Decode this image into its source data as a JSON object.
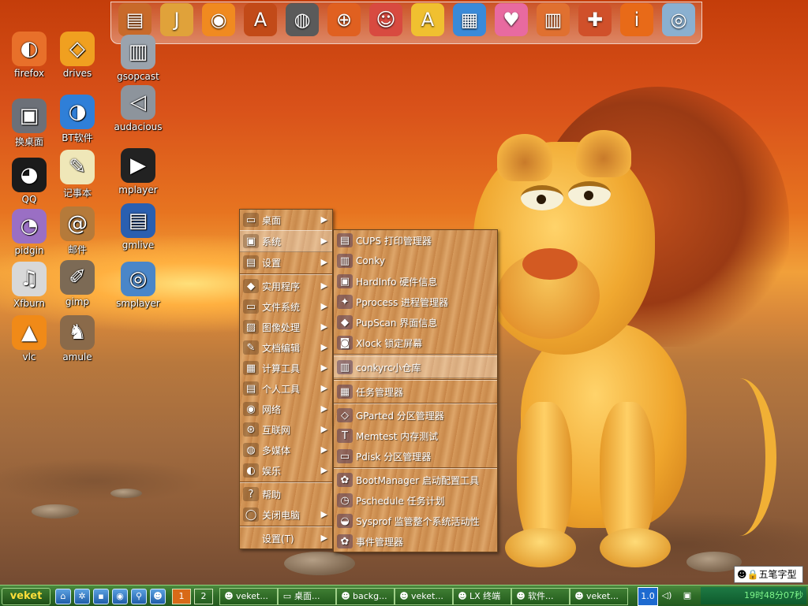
{
  "dock": {
    "icons": [
      {
        "name": "package-icon",
        "glyph": "▤"
      },
      {
        "name": "java-icon",
        "glyph": "J"
      },
      {
        "name": "feeds-icon",
        "glyph": "◉"
      },
      {
        "name": "draw-icon",
        "glyph": "A"
      },
      {
        "name": "media-player-icon",
        "glyph": "◍"
      },
      {
        "name": "globe-icon",
        "glyph": "⊕"
      },
      {
        "name": "cat-icon",
        "glyph": "☺"
      },
      {
        "name": "font-icon",
        "glyph": "A"
      },
      {
        "name": "spreadsheet-icon",
        "glyph": "▦"
      },
      {
        "name": "drink-icon",
        "glyph": "♥"
      },
      {
        "name": "book-icon",
        "glyph": "▥"
      },
      {
        "name": "toolbox-icon",
        "glyph": "✚"
      },
      {
        "name": "info-icon",
        "glyph": "i"
      },
      {
        "name": "database-icon",
        "glyph": "◎"
      }
    ]
  },
  "desktop": {
    "icons": [
      {
        "id": "firefox",
        "label": "firefox",
        "glyph": "◐",
        "bg": "#e8702a"
      },
      {
        "id": "drives",
        "label": "drives",
        "glyph": "◇",
        "bg": "#f0a020"
      },
      {
        "id": "gsopcast",
        "label": "gsopcast",
        "glyph": "▥",
        "bg": "#9aa3ad"
      },
      {
        "id": "switch-desktop",
        "label": "换桌面",
        "glyph": "▣",
        "bg": "#6c7078"
      },
      {
        "id": "bt",
        "label": "BT软件",
        "glyph": "◑",
        "bg": "#2f7fd8"
      },
      {
        "id": "audacious",
        "label": "audacious",
        "glyph": "◁",
        "bg": "#8d949c"
      },
      {
        "id": "qq",
        "label": "QQ",
        "glyph": "◕",
        "bg": "#1b1b1b"
      },
      {
        "id": "notepad",
        "label": "记事本",
        "glyph": "✎",
        "bg": "#efe7b8"
      },
      {
        "id": "mplayer",
        "label": "mplayer",
        "glyph": "▶",
        "bg": "#222222"
      },
      {
        "id": "pidgin",
        "label": "pidgin",
        "glyph": "◔",
        "bg": "#9a6fc4"
      },
      {
        "id": "mail",
        "label": "邮件",
        "glyph": "@",
        "bg": "#b57a3a"
      },
      {
        "id": "gmlive",
        "label": "gmlive",
        "glyph": "▤",
        "bg": "#2a5fb0"
      },
      {
        "id": "xfburn",
        "label": "Xfburn",
        "glyph": "♫",
        "bg": "#d8d8d8"
      },
      {
        "id": "gimp",
        "label": "gimp",
        "glyph": "✐",
        "bg": "#7c6a55"
      },
      {
        "id": "smplayer",
        "label": "smplayer",
        "glyph": "◎",
        "bg": "#4a86c8"
      },
      {
        "id": "vlc",
        "label": "vlc",
        "glyph": "▲",
        "bg": "#f08a18"
      },
      {
        "id": "amule",
        "label": "amule",
        "glyph": "♞",
        "bg": "#8a6a4a"
      }
    ]
  },
  "main_menu": {
    "items": [
      {
        "label": "桌面",
        "icon": "▭",
        "submenu": true
      },
      {
        "label": "系统",
        "icon": "▣",
        "submenu": true,
        "active": true
      },
      {
        "label": "设置",
        "icon": "▤",
        "submenu": true
      },
      {
        "label": "实用程序",
        "icon": "◆",
        "submenu": true
      },
      {
        "label": "文件系统",
        "icon": "▭",
        "submenu": true
      },
      {
        "label": "图像处理",
        "icon": "▨",
        "submenu": true
      },
      {
        "label": "文档编辑",
        "icon": "✎",
        "submenu": true
      },
      {
        "label": "计算工具",
        "icon": "▦",
        "submenu": true
      },
      {
        "label": "个人工具",
        "icon": "▤",
        "submenu": true
      },
      {
        "label": "网络",
        "icon": "◉",
        "submenu": true
      },
      {
        "label": "互联网",
        "icon": "⊛",
        "submenu": true
      },
      {
        "label": "多媒体",
        "icon": "◍",
        "submenu": true
      },
      {
        "label": "娱乐",
        "icon": "◐",
        "submenu": true
      },
      {
        "label": "帮助",
        "icon": "?",
        "submenu": false
      },
      {
        "label": "关闭电脑",
        "icon": "◯",
        "submenu": true
      },
      {
        "label": "设置(T)",
        "icon": "",
        "submenu": true
      }
    ]
  },
  "sub_menu": {
    "items": [
      {
        "label": "CUPS 打印管理器",
        "icon": "▤"
      },
      {
        "label": "Conky",
        "icon": "▥"
      },
      {
        "label": "HardInfo 硬件信息",
        "icon": "▣"
      },
      {
        "label": "Pprocess 进程管理器",
        "icon": "✦"
      },
      {
        "label": "PupScan 界面信息",
        "icon": "◆"
      },
      {
        "label": "Xlock 锁定屏幕",
        "icon": "◙"
      },
      {
        "label": "conkyrc小仓库",
        "icon": "▥",
        "active": true
      },
      {
        "label": "任务管理器",
        "icon": "▦"
      },
      {
        "label": "GParted 分区管理器",
        "icon": "◇"
      },
      {
        "label": "Memtest 内存测试",
        "icon": "T"
      },
      {
        "label": "Pdisk 分区管理器",
        "icon": "▭"
      },
      {
        "label": "BootManager 启动配置工具",
        "icon": "✿"
      },
      {
        "label": "Pschedule 任务计划",
        "icon": "◷"
      },
      {
        "label": "Sysprof 监管整个系统活动性",
        "icon": "◒"
      },
      {
        "label": "事件管理器",
        "icon": "✿"
      }
    ]
  },
  "taskbar": {
    "start_label": "veket",
    "quick": [
      {
        "name": "home-icon",
        "glyph": "⌂"
      },
      {
        "name": "settings-icon",
        "glyph": "✲"
      },
      {
        "name": "terminal-icon",
        "glyph": "▪"
      },
      {
        "name": "browser-icon",
        "glyph": "◉"
      },
      {
        "name": "search-icon",
        "glyph": "⚲"
      },
      {
        "name": "qq-icon",
        "glyph": "☻"
      }
    ],
    "workspaces": [
      "1",
      "2"
    ],
    "tasks": [
      {
        "label": "veket...",
        "icon": "☻"
      },
      {
        "label": "桌面...",
        "icon": "▭"
      },
      {
        "label": "backg...",
        "icon": "☻"
      },
      {
        "label": "veket...",
        "icon": "☻"
      },
      {
        "label": "LX 终端",
        "icon": "☻"
      },
      {
        "label": "软件...",
        "icon": "☻"
      },
      {
        "label": "veket...",
        "icon": "☻"
      }
    ],
    "tray_version": "1.0",
    "clock": "19时48分07秒",
    "ime_label": "五笔字型"
  }
}
